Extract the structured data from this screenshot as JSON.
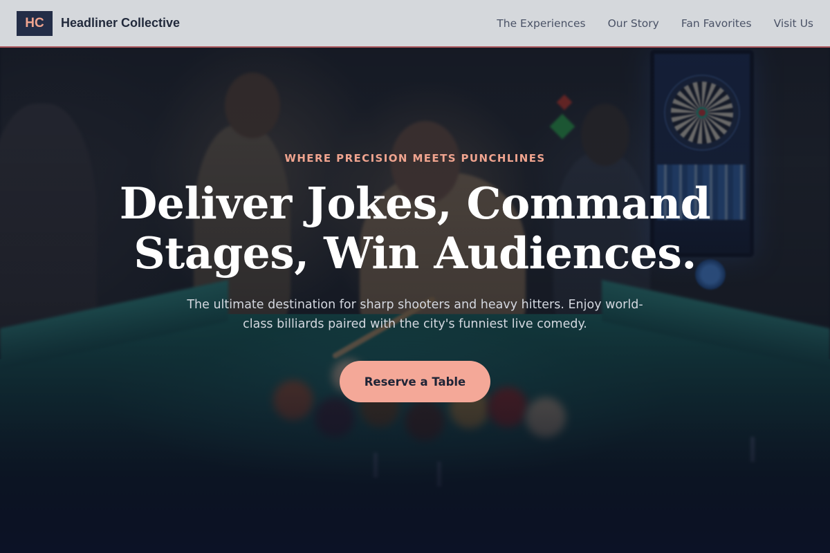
{
  "brand": {
    "logo_text": "HC",
    "name": "Headliner Collective"
  },
  "nav": {
    "items": [
      {
        "label": "The Experiences"
      },
      {
        "label": "Our Story"
      },
      {
        "label": "Fan Favorites"
      },
      {
        "label": "Visit Us"
      }
    ]
  },
  "hero": {
    "eyebrow": "WHERE PRECISION MEETS PUNCHLINES",
    "headline": "Deliver Jokes, Command Stages, Win Audiences.",
    "subtext": "The ultimate destination for sharp shooters and heavy hitters. Enjoy world-class billiards paired with the city's funniest live comedy.",
    "cta_label": "Reserve a Table",
    "background_image": "billiard-room-photo"
  },
  "colors": {
    "accent": "#f4a898",
    "navy": "#232d47",
    "nav_bg": "#d5d8dc",
    "nav_border": "#a8545a"
  }
}
